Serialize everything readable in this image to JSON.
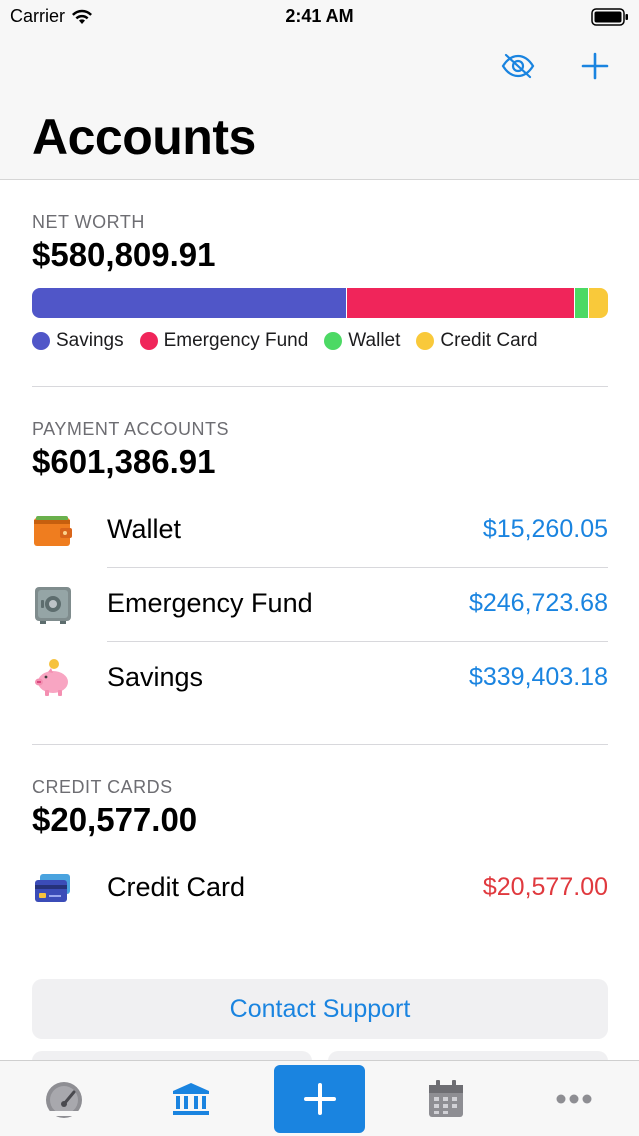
{
  "status_bar": {
    "carrier": "Carrier",
    "time": "2:41 AM"
  },
  "header": {
    "title": "Accounts",
    "icons": [
      "eye-slash-icon",
      "plus-icon"
    ]
  },
  "net_worth": {
    "label": "NET WORTH",
    "total": "$580,809.91",
    "bar": [
      {
        "name": "Savings",
        "color": "#5056c8",
        "fraction": 0.545
      },
      {
        "name": "Emergency Fund",
        "color": "#f0255a",
        "fraction": 0.396
      },
      {
        "name": "Wallet",
        "color": "#4cd964",
        "fraction": 0.024
      },
      {
        "name": "Credit Card",
        "color": "#f9c93a",
        "fraction": 0.035
      }
    ],
    "legend": [
      {
        "label": "Savings",
        "color": "#5056c8"
      },
      {
        "label": "Emergency Fund",
        "color": "#f0255a"
      },
      {
        "label": "Wallet",
        "color": "#4cd964"
      },
      {
        "label": "Credit Card",
        "color": "#f9c93a"
      }
    ]
  },
  "payment_accounts": {
    "label": "PAYMENT ACCOUNTS",
    "total": "$601,386.91",
    "rows": [
      {
        "name": "Wallet",
        "amount": "$15,260.05",
        "icon": "wallet-icon",
        "amount_color": "#1a84e0"
      },
      {
        "name": "Emergency Fund",
        "amount": "$246,723.68",
        "icon": "safe-icon",
        "amount_color": "#1a84e0"
      },
      {
        "name": "Savings",
        "amount": "$339,403.18",
        "icon": "piggy-bank-icon",
        "amount_color": "#1a84e0"
      }
    ]
  },
  "credit_cards": {
    "label": "CREDIT CARDS",
    "total": "$20,577.00",
    "rows": [
      {
        "name": "Credit Card",
        "amount": "$20,577.00",
        "icon": "credit-card-icon",
        "amount_color": "#e0393e"
      }
    ]
  },
  "support": {
    "label": "Contact Support"
  },
  "tab_bar": {
    "tabs": [
      "dashboard-icon",
      "bank-icon",
      "add-icon",
      "calendar-icon",
      "more-icon"
    ],
    "active": "bank-icon",
    "accent": "#1a84e0"
  }
}
